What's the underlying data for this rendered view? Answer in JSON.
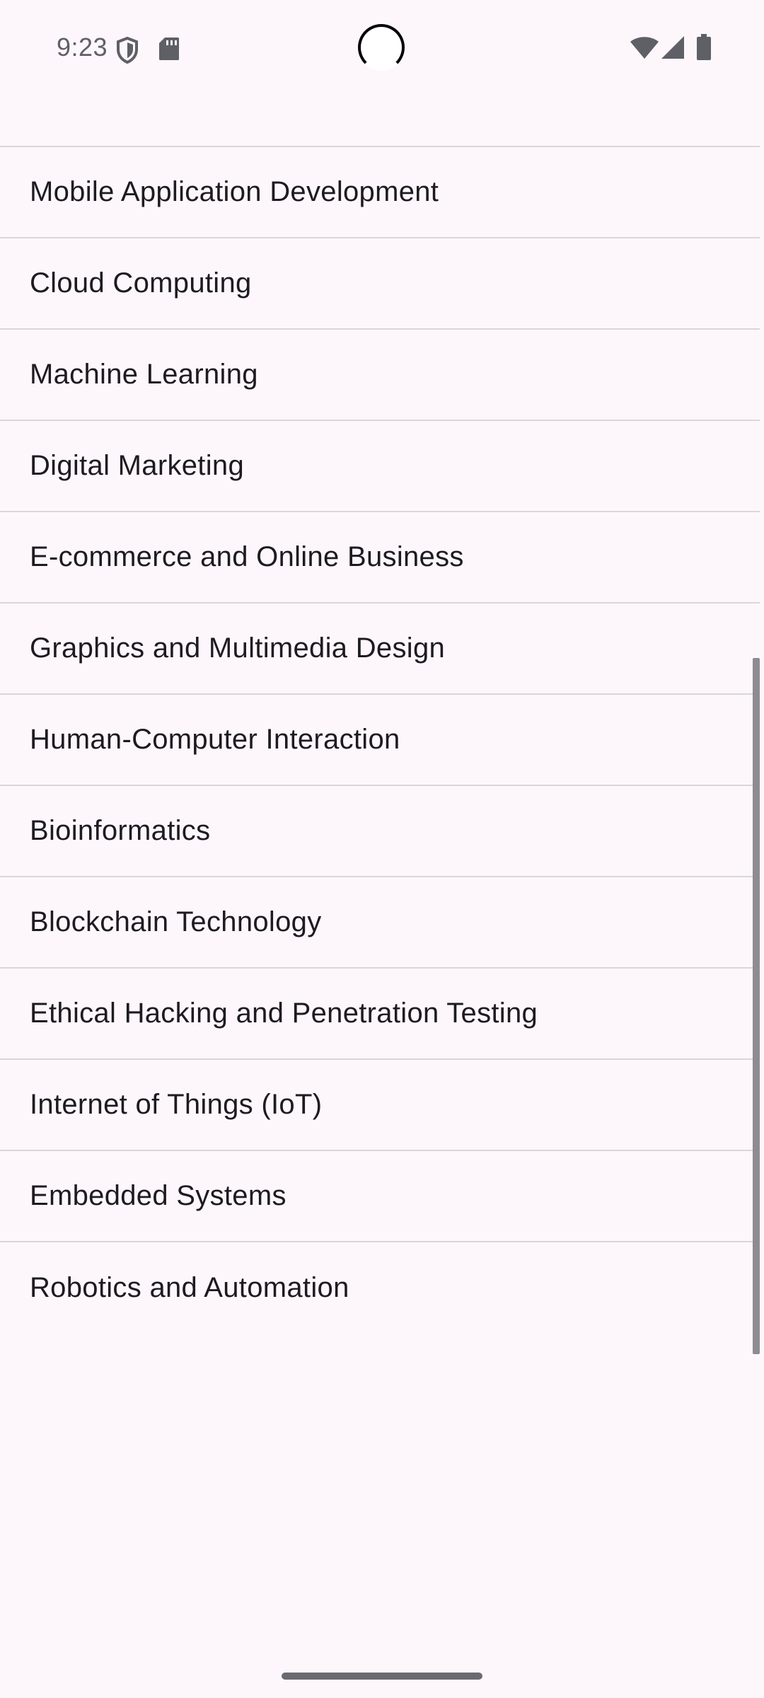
{
  "status_bar": {
    "time": "9:23",
    "left_icons": [
      "shield-icon",
      "sd-card-icon"
    ],
    "right_icons": [
      "wifi-icon",
      "cellular-signal-icon",
      "battery-icon"
    ]
  },
  "topics": [
    {
      "label": "Mobile Application Development"
    },
    {
      "label": "Cloud Computing"
    },
    {
      "label": "Machine Learning"
    },
    {
      "label": "Digital Marketing"
    },
    {
      "label": "E-commerce and Online Business"
    },
    {
      "label": "Graphics and Multimedia Design"
    },
    {
      "label": "Human-Computer Interaction"
    },
    {
      "label": "Bioinformatics"
    },
    {
      "label": "Blockchain Technology"
    },
    {
      "label": "Ethical Hacking and Penetration Testing"
    },
    {
      "label": "Internet of Things (IoT)"
    },
    {
      "label": "Embedded Systems"
    },
    {
      "label": "Robotics and Automation"
    }
  ],
  "colors": {
    "background": "#fdf7fb",
    "divider": "#d9d6d9",
    "text": "#1e1b20",
    "status_text": "#5f5f66",
    "scrollbar": "#8e8c91"
  }
}
